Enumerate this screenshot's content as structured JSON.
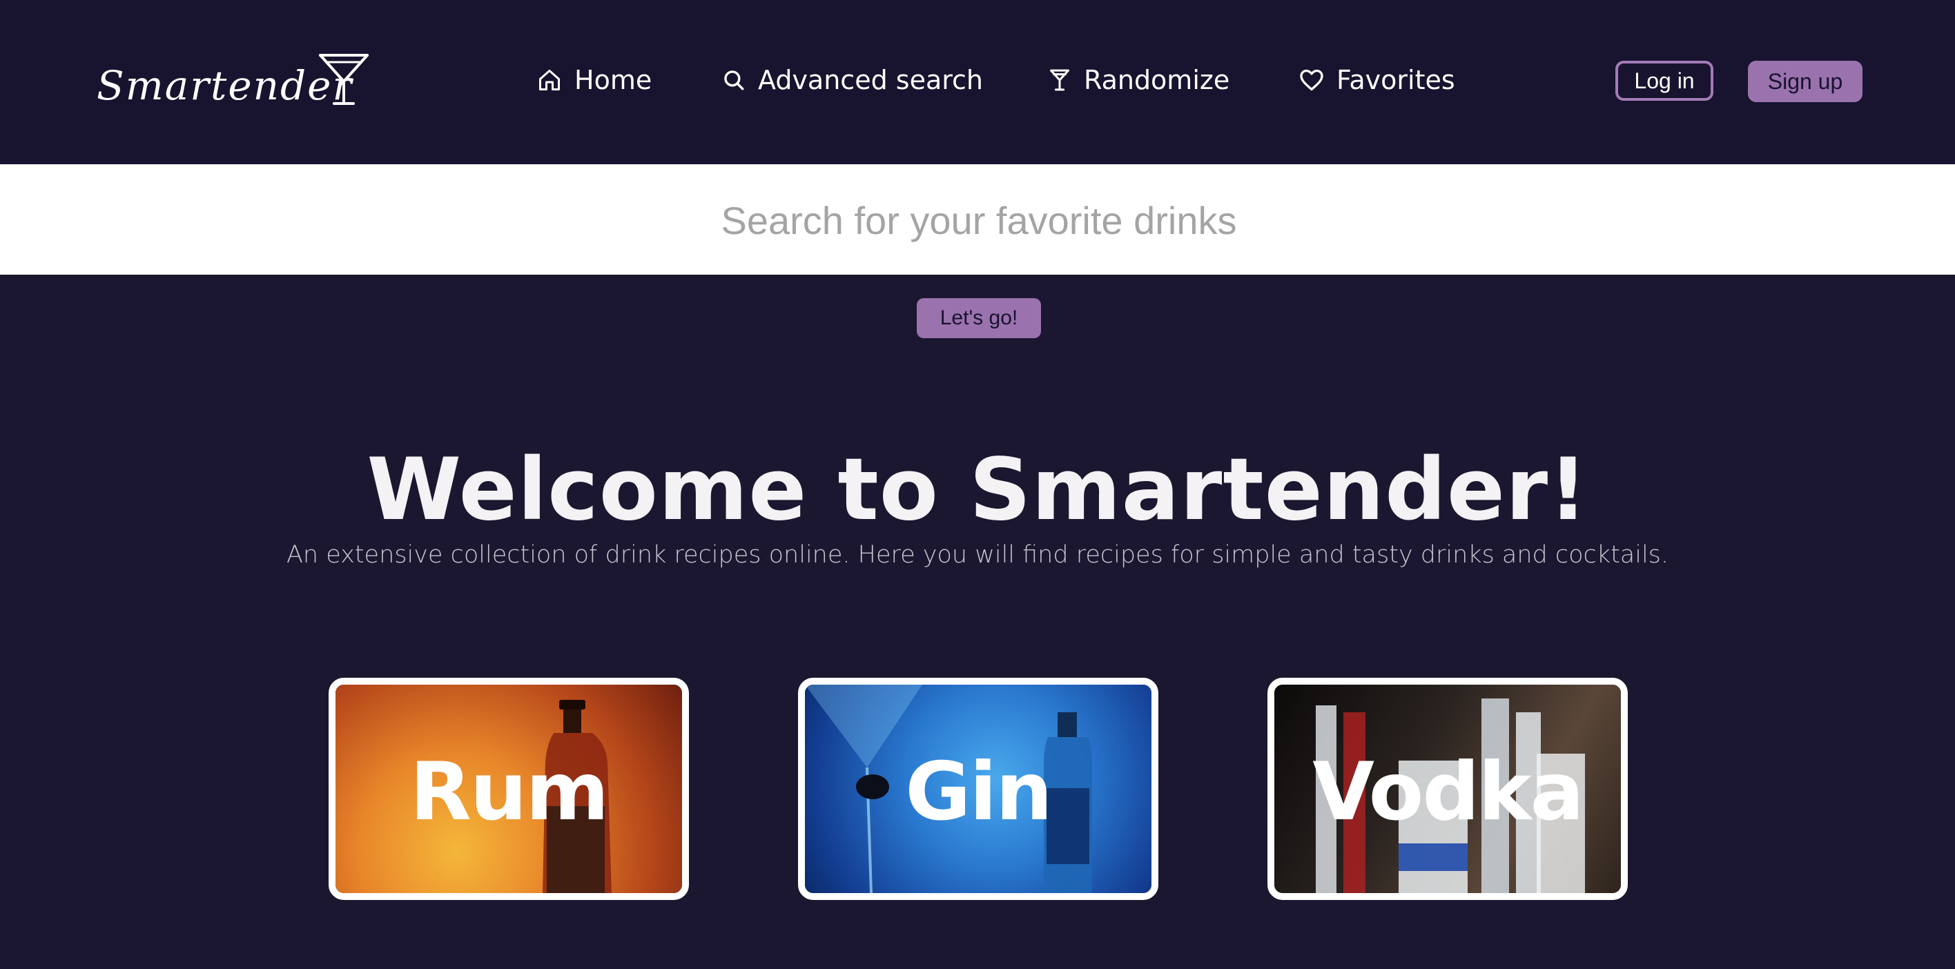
{
  "brand": {
    "logo_text": "Smartender",
    "logo_icon": "cocktail-glass-icon"
  },
  "nav": {
    "items": [
      {
        "label": "Home",
        "icon": "home-icon"
      },
      {
        "label": "Advanced search",
        "icon": "search-icon"
      },
      {
        "label": "Randomize",
        "icon": "cocktail-glass-icon"
      },
      {
        "label": "Favorites",
        "icon": "heart-icon"
      }
    ]
  },
  "auth": {
    "login_label": "Log in",
    "signup_label": "Sign up"
  },
  "search": {
    "placeholder": "Search for your favorite drinks",
    "value": "",
    "submit_label": "Let's go!"
  },
  "hero": {
    "title": "Welcome to Smartender!",
    "subtitle": "An extensive collection of drink recipes online. Here you will find recipes for simple and tasty drinks and cocktails."
  },
  "categories": [
    {
      "label": "Rum"
    },
    {
      "label": "Gin"
    },
    {
      "label": "Vodka"
    }
  ],
  "colors": {
    "background": "#1b1730",
    "header_background": "#18132f",
    "accent": "#9a72ad",
    "text_primary": "#ffffff"
  }
}
